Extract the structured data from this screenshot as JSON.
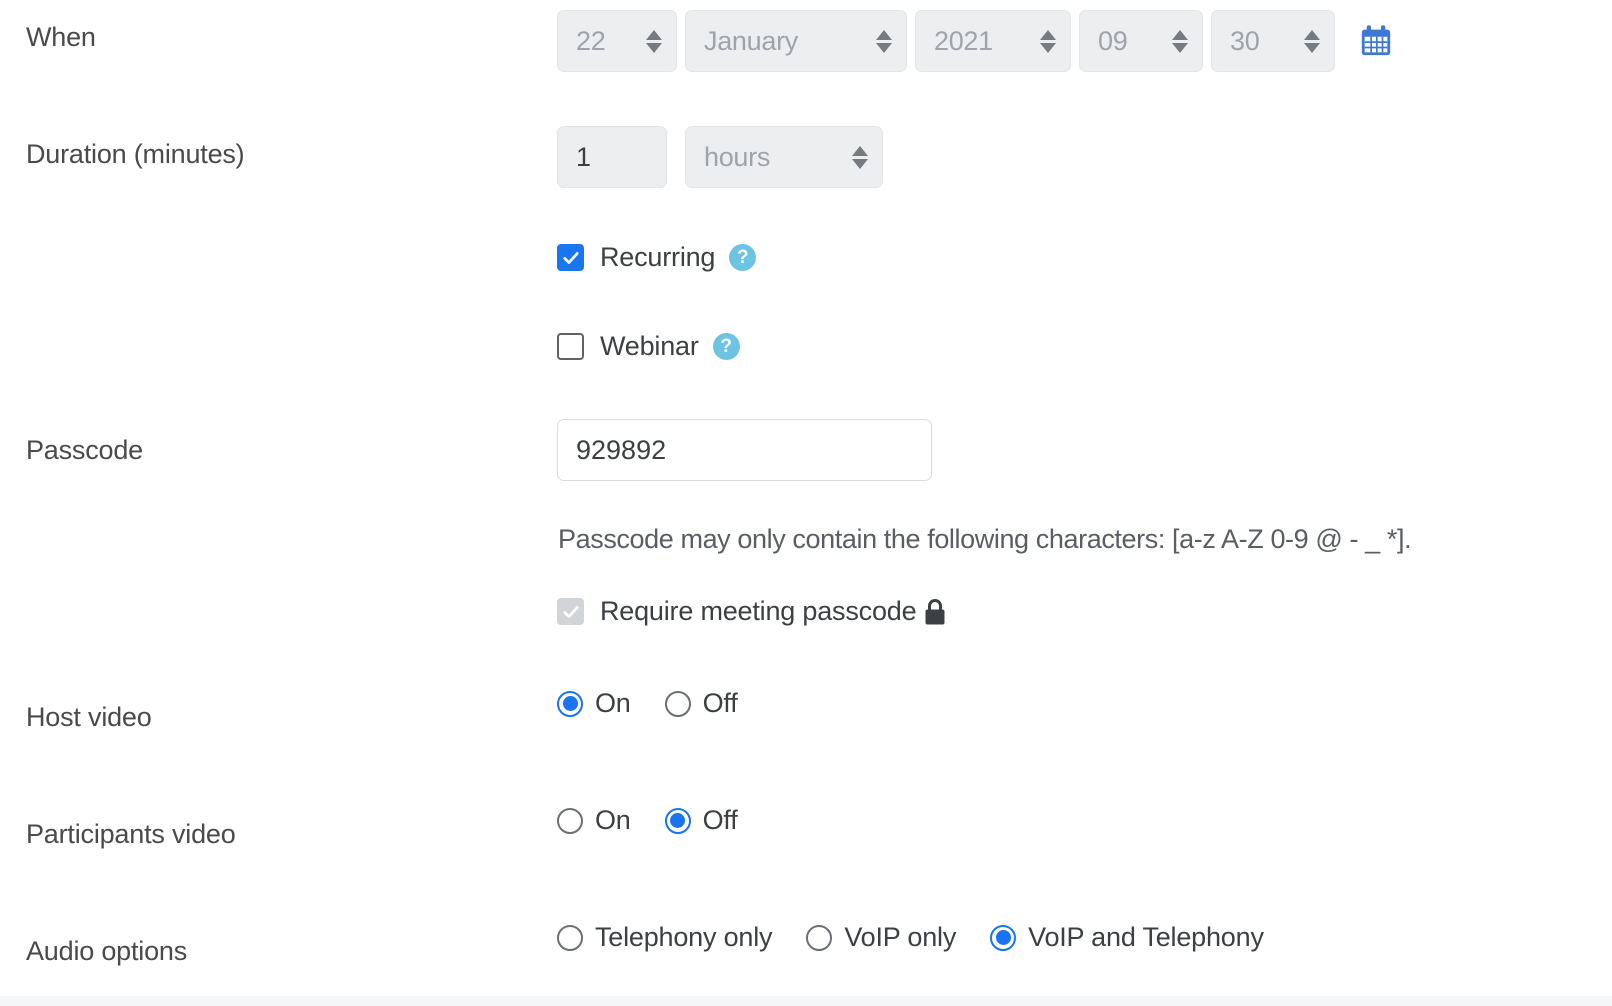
{
  "form": {
    "rows": {
      "when": {
        "label": "When",
        "day": "22",
        "month": "January",
        "year": "2021",
        "hour": "09",
        "minute": "30",
        "calendar_icon": "calendar-icon"
      },
      "duration": {
        "label": "Duration (minutes)",
        "amount": "1",
        "unit": "hours"
      },
      "recurring": {
        "label": "Recurring",
        "checked": "true",
        "help_icon": "help-icon"
      },
      "webinar": {
        "label": "Webinar",
        "checked": "false",
        "help_icon": "help-icon"
      },
      "passcode": {
        "label": "Passcode",
        "value": "929892",
        "placeholder": "Passcode",
        "hint": "Passcode may only contain the following characters: [a-z A-Z 0-9 @ - _ *].",
        "require_label": "Require meeting passcode",
        "require_checked": "true",
        "lock_icon": "lock-icon"
      },
      "host_video": {
        "label": "Host video",
        "options": [
          {
            "label": "On",
            "selected": "true"
          },
          {
            "label": "Off",
            "selected": "false"
          }
        ]
      },
      "participants_video": {
        "label": "Participants video",
        "options": [
          {
            "label": "On",
            "selected": "false"
          },
          {
            "label": "Off",
            "selected": "true"
          }
        ]
      },
      "audio_options": {
        "label": "Audio options",
        "options": [
          {
            "label": "Telephony only",
            "selected": "false"
          },
          {
            "label": "VoIP only",
            "selected": "false"
          },
          {
            "label": "VoIP and Telephony",
            "selected": "true"
          }
        ]
      }
    }
  },
  "colors": {
    "accent_blue": "#1976f2",
    "radio_blue": "#1a73f0",
    "help_blue": "#6dc4e2",
    "calendar_blue": "#3b78d8",
    "control_bg": "#eceef0",
    "text": "#3c4043",
    "muted_text": "#9ea4aa"
  }
}
